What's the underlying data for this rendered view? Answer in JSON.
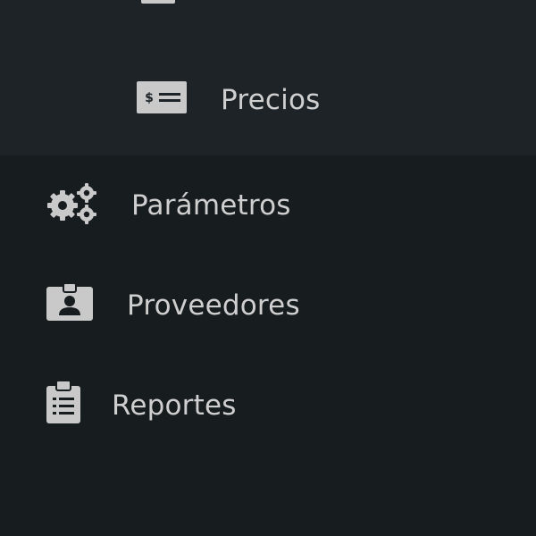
{
  "sidebar": {
    "submenu": {
      "items": [
        {
          "label": "Precios",
          "icon": "money-bill-icon"
        }
      ]
    },
    "items": [
      {
        "label": "Parámetros",
        "icon": "cogs-icon"
      },
      {
        "label": "Proveedores",
        "icon": "id-badge-icon"
      },
      {
        "label": "Reportes",
        "icon": "clipboard-list-icon"
      }
    ]
  },
  "colors": {
    "sidebar_bg": "#171c1f",
    "submenu_bg": "#1d2327",
    "text": "#cfcfcf",
    "icon": "#c9c9c9"
  }
}
